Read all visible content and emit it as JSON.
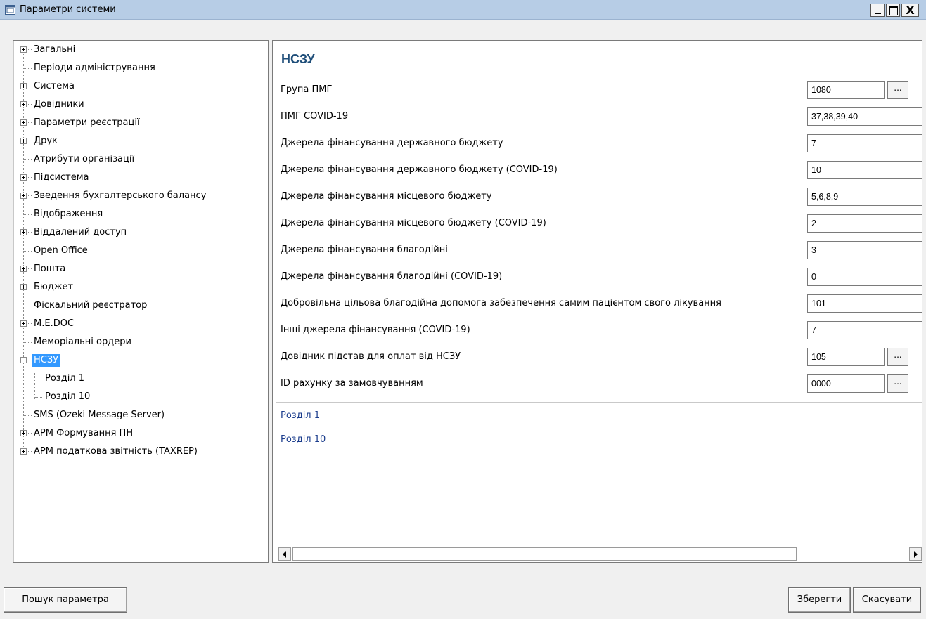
{
  "window": {
    "title": "Параметри системи",
    "close_symbol": "X"
  },
  "tree": {
    "items": [
      {
        "label": "Загальні",
        "expandable": true
      },
      {
        "label": "Періоди адміністрування",
        "expandable": false
      },
      {
        "label": "Система",
        "expandable": true
      },
      {
        "label": "Довідники",
        "expandable": true
      },
      {
        "label": "Параметри реєстрації",
        "expandable": true
      },
      {
        "label": "Друк",
        "expandable": true
      },
      {
        "label": "Атрибути організації",
        "expandable": false
      },
      {
        "label": "Підсистема",
        "expandable": true
      },
      {
        "label": "Зведення бухгалтерського балансу",
        "expandable": true
      },
      {
        "label": "Відображення",
        "expandable": false
      },
      {
        "label": "Віддалений доступ",
        "expandable": true
      },
      {
        "label": "Open Office",
        "expandable": false
      },
      {
        "label": "Пошта",
        "expandable": true
      },
      {
        "label": "Бюджет",
        "expandable": true
      },
      {
        "label": "Фіскальний реєстратор",
        "expandable": false
      },
      {
        "label": "M.E.DOC",
        "expandable": true
      },
      {
        "label": "Меморіальні ордери",
        "expandable": false
      },
      {
        "label": "НСЗУ",
        "expandable": true,
        "expanded": true,
        "selected": true
      },
      {
        "label": "Розділ 1",
        "expandable": false,
        "child": true
      },
      {
        "label": "Розділ 10",
        "expandable": false,
        "child": true
      },
      {
        "label": "SMS (Ozeki Message Server)",
        "expandable": false
      },
      {
        "label": "АРМ Формування ПН",
        "expandable": true
      },
      {
        "label": "АРМ податкова звітність (TAXREP)",
        "expandable": true
      }
    ]
  },
  "content": {
    "section_title": "НСЗУ",
    "params": [
      {
        "label": "Група ПМГ",
        "value": "1080",
        "has_button": true
      },
      {
        "label": "ПМГ COVID-19",
        "value": "37,38,39,40",
        "has_button": false
      },
      {
        "label": "Джерела фінансування державного бюджету",
        "value": "7",
        "has_button": false
      },
      {
        "label": "Джерела фінансування державного бюджету (COVID-19)",
        "value": "10",
        "has_button": false
      },
      {
        "label": "Джерела фінансування місцевого бюджету",
        "value": "5,6,8,9",
        "has_button": false
      },
      {
        "label": "Джерела фінансування місцевого бюджету (COVID-19)",
        "value": "2",
        "has_button": false
      },
      {
        "label": "Джерела фінансування благодійні",
        "value": "3",
        "has_button": false
      },
      {
        "label": "Джерела фінансування благодійні (COVID-19)",
        "value": "0",
        "has_button": false
      },
      {
        "label": "Добровільна цільова благодійна допомога забезпечення самим пацієнтом свого лікування",
        "value": "101",
        "has_button": false
      },
      {
        "label": "Інші джерела фінансування (COVID-19)",
        "value": "7",
        "has_button": false
      },
      {
        "label": "Довідник підстав для оплат від НСЗУ",
        "value": "105",
        "has_button": true
      },
      {
        "label": "ID рахунку за замовчуванням",
        "value": "0000",
        "has_button": true
      }
    ],
    "ellipsis_label": "...",
    "links": [
      "Розділ 1",
      "Розділ 10"
    ]
  },
  "buttons": {
    "search": "Пошук параметра",
    "save": "Зберегти",
    "cancel": "Скасувати"
  }
}
